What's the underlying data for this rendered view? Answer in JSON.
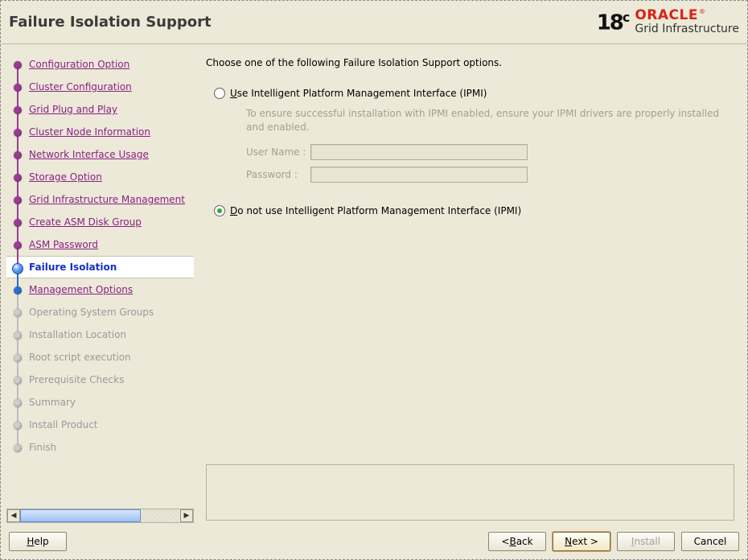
{
  "header": {
    "title": "Failure Isolation Support",
    "brand": {
      "ver": "18",
      "vc": "c",
      "oracle": "ORACLE",
      "reg": "®",
      "sub": "Grid Infrastructure"
    }
  },
  "sidebar": {
    "steps": [
      {
        "label": "Configuration Option",
        "state": "done"
      },
      {
        "label": "Cluster Configuration",
        "state": "done"
      },
      {
        "label": "Grid Plug and Play",
        "state": "done"
      },
      {
        "label": "Cluster Node Information",
        "state": "done"
      },
      {
        "label": "Network Interface Usage",
        "state": "done"
      },
      {
        "label": "Storage Option",
        "state": "done"
      },
      {
        "label": "Grid Infrastructure Management",
        "state": "done"
      },
      {
        "label": "Create ASM Disk Group",
        "state": "done"
      },
      {
        "label": "ASM Password",
        "state": "done"
      },
      {
        "label": "Failure Isolation",
        "state": "current"
      },
      {
        "label": "Management Options",
        "state": "upcoming"
      },
      {
        "label": "Operating System Groups",
        "state": "future"
      },
      {
        "label": "Installation Location",
        "state": "future"
      },
      {
        "label": "Root script execution",
        "state": "future"
      },
      {
        "label": "Prerequisite Checks",
        "state": "future"
      },
      {
        "label": "Summary",
        "state": "future"
      },
      {
        "label": "Install Product",
        "state": "future"
      },
      {
        "label": "Finish",
        "state": "future"
      }
    ]
  },
  "main": {
    "instruction": "Choose one of the following Failure Isolation Support options.",
    "opt1": {
      "prefix": "U",
      "rest": "se Intelligent Platform Management Interface (IPMI)",
      "selected": false,
      "note": "To ensure successful installation with IPMI enabled, ensure your IPMI drivers are properly installed and enabled.",
      "user_label": "User Name :",
      "pass_label": "Password :",
      "user_value": "",
      "pass_value": ""
    },
    "opt2": {
      "prefix": "D",
      "rest": "o not use Intelligent Platform Management Interface (IPMI)",
      "selected": true
    }
  },
  "footer": {
    "help": {
      "mn": "H",
      "rest": "elp"
    },
    "back": {
      "pre": "< ",
      "mn": "B",
      "rest": "ack"
    },
    "next": {
      "mn": "N",
      "rest": "ext >"
    },
    "install": {
      "mn": "I",
      "rest": "nstall"
    },
    "cancel": {
      "label": "Cancel"
    }
  }
}
